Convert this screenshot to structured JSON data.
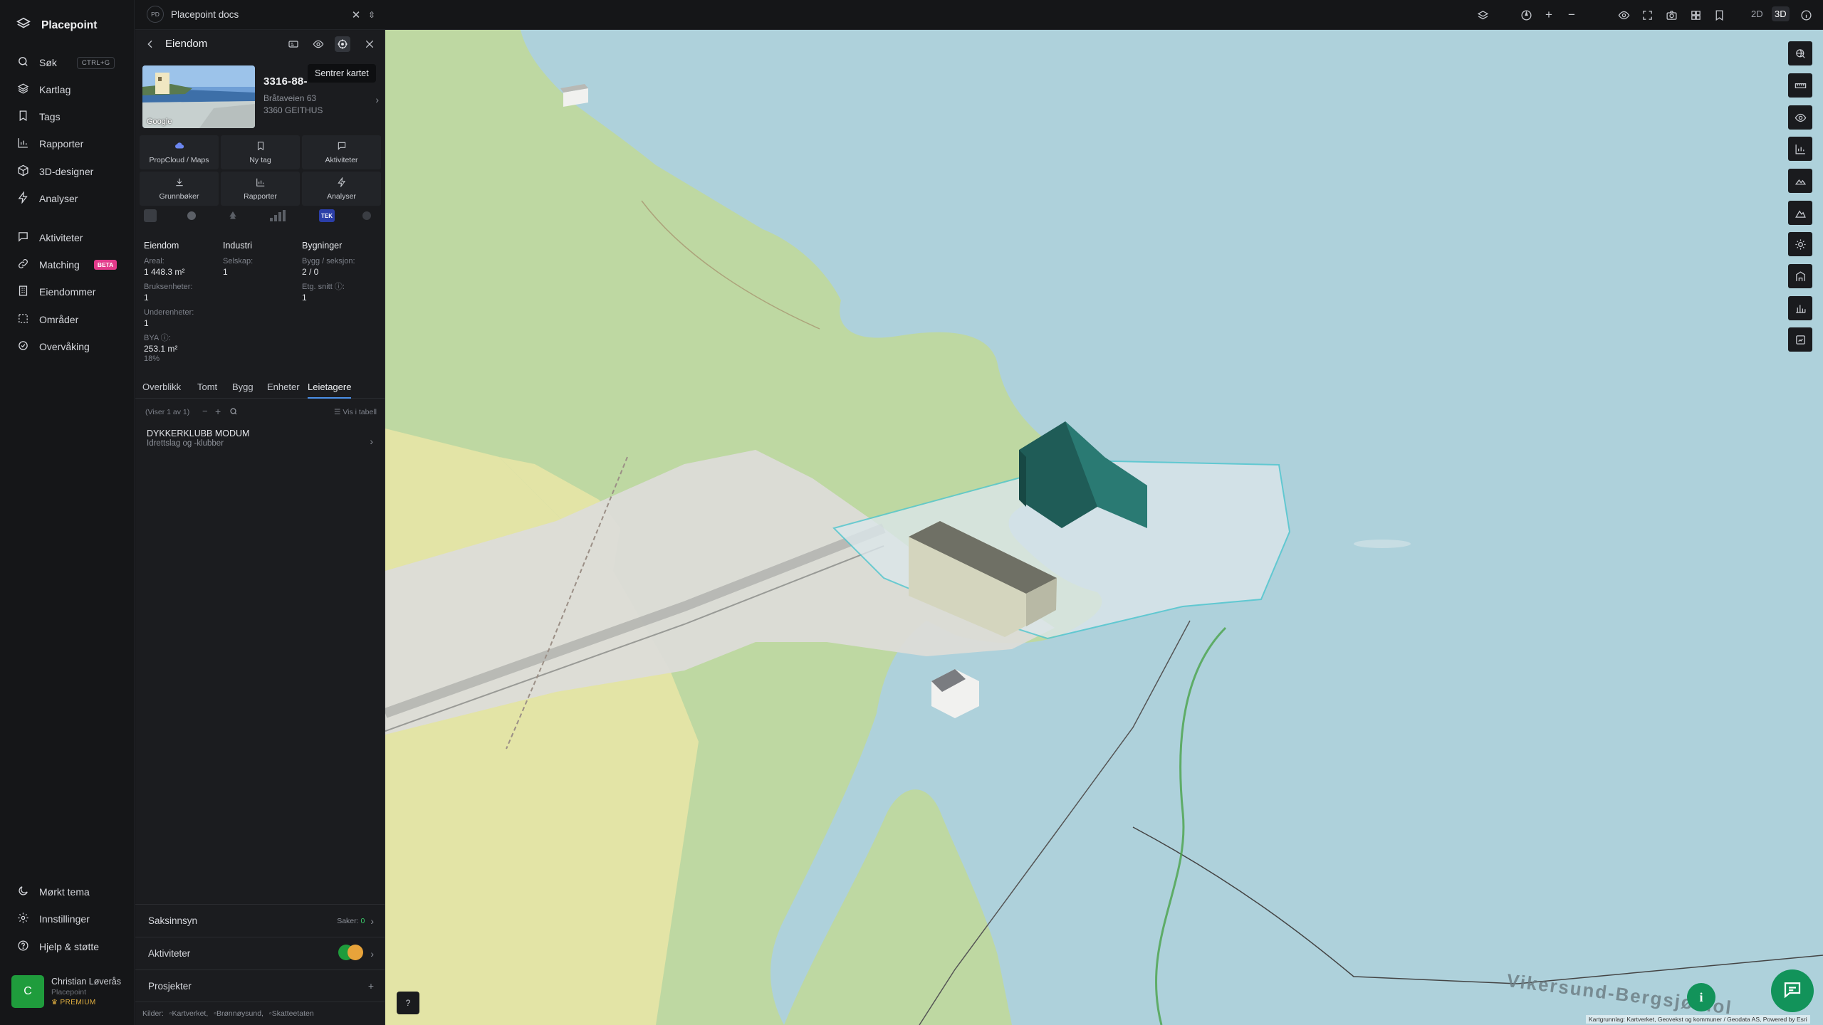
{
  "app": {
    "name": "Placepoint"
  },
  "nav": {
    "items": [
      {
        "label": "Søk",
        "kbd": "CTRL+G",
        "icon": "search-icon"
      },
      {
        "label": "Kartlag",
        "icon": "layers-icon"
      },
      {
        "label": "Tags",
        "icon": "bookmark-icon"
      },
      {
        "label": "Rapporter",
        "icon": "bar-chart-icon"
      },
      {
        "label": "3D-designer",
        "icon": "cube-icon"
      },
      {
        "label": "Analyser",
        "icon": "lightning-icon"
      },
      {
        "label": "Aktiviteter",
        "icon": "chat-icon"
      },
      {
        "label": "Matching",
        "badge": "BETA",
        "icon": "link-icon"
      },
      {
        "label": "Eiendommer",
        "icon": "building-icon"
      },
      {
        "label": "Områder",
        "icon": "area-icon"
      },
      {
        "label": "Overvåking",
        "icon": "eye-check-icon"
      }
    ],
    "bottom": [
      {
        "label": "Mørkt tema",
        "icon": "moon-icon"
      },
      {
        "label": "Innstillinger",
        "icon": "gear-icon"
      },
      {
        "label": "Hjelp & støtte",
        "icon": "help-icon"
      }
    ],
    "user": {
      "initial": "C",
      "name": "Christian Løverås",
      "org": "Placepoint",
      "plan": "PREMIUM"
    }
  },
  "topbar": {
    "doc_badge": "PD",
    "doc_title": "Placepoint docs",
    "modes": [
      "2D",
      "3D"
    ],
    "active_mode": "3D"
  },
  "panel": {
    "title": "Eiendom",
    "tooltip": "Sentrer kartet",
    "photo_label": "Google",
    "property": {
      "id": "3316-88-",
      "address_line1": "Bråtaveien 63",
      "address_line2": "3360 GEITHUS"
    },
    "quick_actions": [
      {
        "label": "PropCloud / Maps",
        "icon": "cloud-icon"
      },
      {
        "label": "Ny tag",
        "icon": "bookmark-icon"
      },
      {
        "label": "Aktiviteter",
        "icon": "chat-icon"
      },
      {
        "label": "Grunnbøker",
        "icon": "download-icon"
      },
      {
        "label": "Rapporter",
        "icon": "bar-chart-icon"
      },
      {
        "label": "Analyser",
        "icon": "lightning-icon"
      }
    ],
    "mini_badge": "TEK",
    "stats": {
      "eiendom": {
        "heading": "Eiendom",
        "areal_label": "Areal:",
        "areal_value": "1 448.3 m²",
        "bruks_label": "Bruksenheter:",
        "bruks_value": "1",
        "under_label": "Underenheter:",
        "under_value": "1",
        "bya_label": "BYA ⓘ:",
        "bya_value": "253.1 m²",
        "bya_pct": "18%"
      },
      "industri": {
        "heading": "Industri",
        "selskap_label": "Selskap:",
        "selskap_value": "1"
      },
      "bygninger": {
        "heading": "Bygninger",
        "bygg_label": "Bygg / seksjon:",
        "bygg_value": "2 / 0",
        "etg_label": "Etg. snitt ⓘ:",
        "etg_value": "1"
      }
    },
    "tabs": [
      "Overblikk",
      "Tomt",
      "Bygg",
      "Enheter",
      "Leietagere"
    ],
    "active_tab": "Leietagere",
    "list": {
      "count_text": "(Viser 1 av 1)",
      "table_link": "Vis i tabell"
    },
    "tenants": [
      {
        "name": "DYKKERKLUBB MODUM",
        "desc": "Idrettslag og -klubber"
      }
    ],
    "sections": {
      "saksinnsyn": {
        "label": "Saksinnsyn",
        "meta_label": "Saker:",
        "meta_value": "0"
      },
      "aktiviteter": {
        "label": "Aktiviteter"
      },
      "prosjekter": {
        "label": "Prosjekter",
        "action": "+"
      }
    },
    "sources": {
      "label": "Kilder:",
      "items": [
        "Kartverket,",
        "Brønnøysund,",
        "Skatteetaten"
      ]
    }
  },
  "map": {
    "place_label": "Vikersund-Bergsjø hol",
    "attribution": "Kartgrunnlag: Kartverket, Geovekst og kommuner / Geodata AS, Powered by Esri",
    "colors": {
      "water": "#aed1db",
      "land_green": "#bed8a2",
      "land_yellow": "#e3e4a6",
      "road": "#dcdcd8",
      "building_selected": "#1f5c57",
      "parcel": "#4fc6cf"
    }
  }
}
